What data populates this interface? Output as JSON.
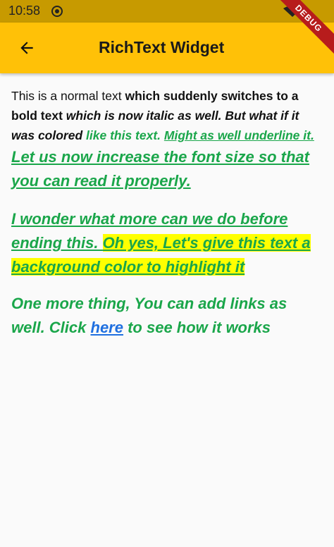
{
  "status_bar": {
    "time": "10:58",
    "debug_label": "DEBUG"
  },
  "app_bar": {
    "title": "RichText Widget",
    "back_icon": "arrow-back-icon"
  },
  "paragraph1": {
    "normal": "This is a normal text ",
    "bold": "which suddenly switches to a bold text ",
    "italic": "which is now italic as well. But what if it was colored ",
    "colored": "like this text. ",
    "underlined": "Might as well underline it."
  },
  "big_text": "Let us now increase the font size so that you can read it properly.",
  "paragraph2": {
    "wonder": "I wonder what more can we do before ending this. ",
    "highlight": "Oh yes, Let's give this text a background color to highlight it"
  },
  "paragraph3": {
    "before_link": "One more thing, You can add links as well. Click ",
    "link": "here",
    "after_link": " to see how it works"
  },
  "colors": {
    "app_bar": "#ffc107",
    "status_bar": "#c79a00",
    "green": "#1aa64a",
    "link": "#1e6fe0",
    "highlight": "#ffff00"
  }
}
